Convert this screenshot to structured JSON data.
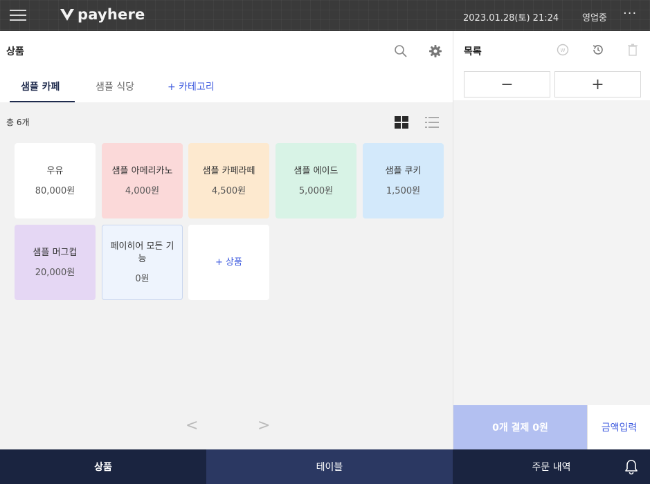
{
  "header": {
    "brand": "payhere",
    "datetime": "2023.01.28(토) 21:24",
    "status": "영업중",
    "more": "···"
  },
  "products": {
    "title": "상품",
    "tabs": [
      "샘플 카페",
      "샘플 식당",
      "+ 카테고리"
    ],
    "count": "총 6개",
    "cards": [
      {
        "name": "우유",
        "price": "80,000원",
        "color": "#ffffff"
      },
      {
        "name": "샘플 아메리카노",
        "price": "4,000원",
        "color": "#fbd9d9"
      },
      {
        "name": "샘플 카페라떼",
        "price": "4,500원",
        "color": "#fde9cf"
      },
      {
        "name": "샘플 에이드",
        "price": "5,000원",
        "color": "#d8f3e6"
      },
      {
        "name": "샘플 쿠키",
        "price": "1,500원",
        "color": "#d3e9fb"
      },
      {
        "name": "샘플 머그컵",
        "price": "20,000원",
        "color": "#e5d7f4"
      },
      {
        "name": "페이히어 모든 기능",
        "price": "0원",
        "color": "#eef4fd"
      },
      {
        "name": "+ 상품",
        "price": "",
        "color": "#ffffff"
      }
    ],
    "pager_prev": "<",
    "pager_next": ">"
  },
  "order": {
    "title": "목록",
    "minus": "−",
    "plus": "+",
    "pay_label": "0개 결제 0원",
    "amount_label": "금액입력"
  },
  "nav": {
    "items": [
      "상품",
      "테이블",
      "주문 내역"
    ]
  },
  "colors": {
    "accent": "#3d5adf",
    "nav_dark": "#1a2440",
    "nav_mid": "#2b3862",
    "pay": "#b3c0f1"
  }
}
